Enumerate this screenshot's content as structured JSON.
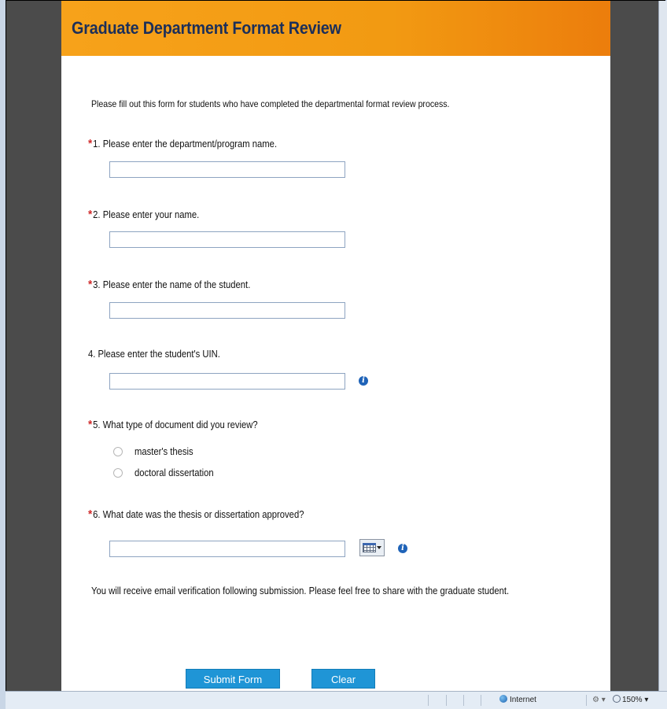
{
  "form": {
    "title": "Graduate Department Format Review",
    "intro": "Please fill out this form for students who have completed the departmental format review process.",
    "questions": [
      {
        "number": "1.",
        "text": "Please enter the department/program name.",
        "required": true,
        "value": ""
      },
      {
        "number": "2.",
        "text": "Please enter your name.",
        "required": true,
        "value": ""
      },
      {
        "number": "3.",
        "text": "Please enter the name of the student.",
        "required": true,
        "value": ""
      },
      {
        "number": "4.",
        "text": "Please enter the student's UIN.",
        "required": false,
        "value": ""
      },
      {
        "number": "5.",
        "text": "What type of document did you review?",
        "required": true,
        "options": [
          "master's thesis",
          "doctoral dissertation"
        ],
        "selected": null
      },
      {
        "number": "6.",
        "text": "What date was the thesis or dissertation approved?",
        "required": true,
        "value": ""
      }
    ],
    "required_marker": "*",
    "info_icon_glyph": "i",
    "footer_note": "You will receive email verification following submission. Please feel free to share with the graduate student.",
    "buttons": {
      "submit": "Submit Form",
      "clear": "Clear"
    }
  },
  "status_bar": {
    "zone": "Internet",
    "zoom": "150%",
    "dropdown_glyph": "▾"
  },
  "colors": {
    "header_orange": "#f29a12",
    "title_navy": "#1c2f59",
    "required_red": "#d02b2b",
    "button_blue": "#1f95d6",
    "info_blue": "#1f63b8"
  }
}
